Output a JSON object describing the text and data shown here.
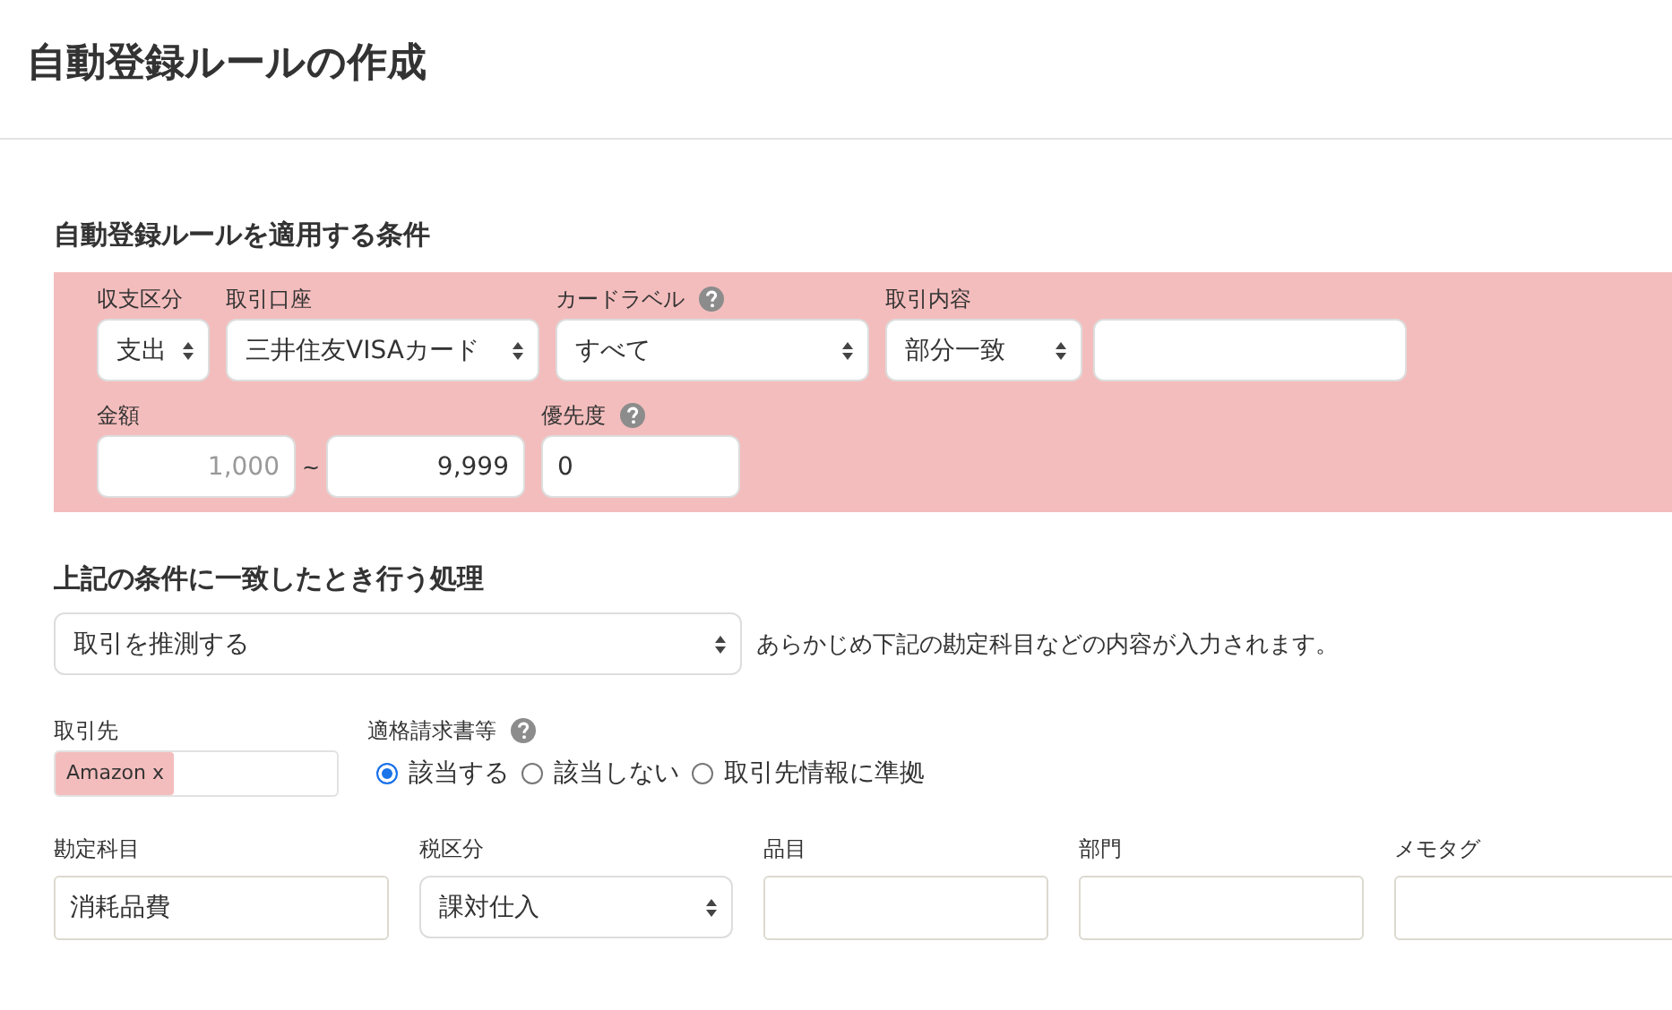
{
  "page": {
    "title": "自動登録ルールの作成"
  },
  "conditions": {
    "heading": "自動登録ルールを適用する条件",
    "top_fields": [
      {
        "kind": "select",
        "label": "収支区分",
        "help": false,
        "value": "支出"
      },
      {
        "kind": "select",
        "label": "取引口座",
        "help": false,
        "value": "三井住友VISAカード"
      },
      {
        "kind": "select",
        "label": "カードラベル",
        "help": true,
        "value": "すべて"
      },
      {
        "kind": "select",
        "label": "取引内容",
        "help": false,
        "value": "部分一致"
      },
      {
        "kind": "text",
        "help": false
      }
    ],
    "bottom_fields": [
      {
        "kind": "range",
        "label": "金額",
        "help": false,
        "min_placeholder": "1,000",
        "separator": "~",
        "max_value": "9,999"
      },
      {
        "kind": "text",
        "label": "優先度",
        "help": true,
        "value": "0"
      }
    ]
  },
  "action": {
    "heading": "上記の条件に一致したとき行う処理",
    "select": {
      "value": "取引を推測する"
    },
    "note": "あらかじめ下記の勘定科目などの内容が入力されます。",
    "partner": {
      "label": "取引先",
      "tags": [
        {
          "label": "Amazon x"
        }
      ]
    },
    "invoice": {
      "label": "適格請求書等",
      "help": true,
      "options": [
        {
          "label": "該当する",
          "selected": true
        },
        {
          "label": "該当しない",
          "selected": false
        },
        {
          "label": "取引先情報に準拠",
          "selected": false
        }
      ]
    },
    "fields": [
      {
        "kind": "text",
        "label": "勘定科目",
        "value": "消耗品費"
      },
      {
        "kind": "select",
        "label": "税区分",
        "value": "課対仕入"
      },
      {
        "kind": "text",
        "label": "品目"
      },
      {
        "kind": "text",
        "label": "部門"
      },
      {
        "kind": "text",
        "label": "メモタグ"
      }
    ]
  }
}
